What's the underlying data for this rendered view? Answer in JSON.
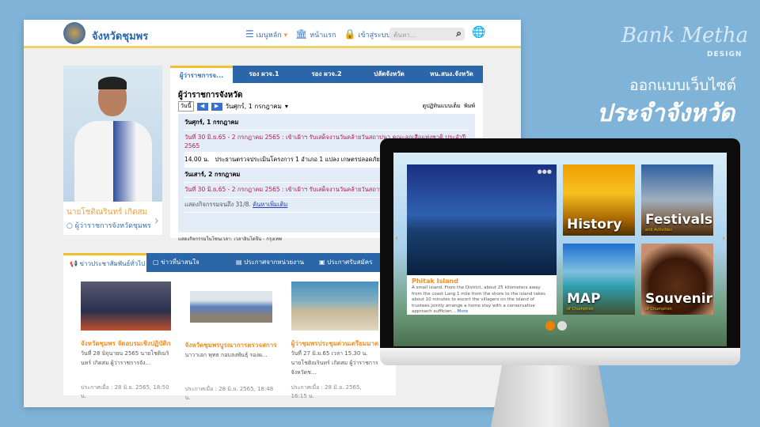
{
  "header": {
    "site_title": "จังหวัดชุมพร",
    "menu": "เมนูหลัก",
    "home": "หน้าแรก",
    "login": "เข้าสู่ระบบ",
    "search_placeholder": "ค้นหา..."
  },
  "profile": {
    "name": "นายโชติณรินทร์ เกิดสม",
    "role": "ผู้ว่าราชการจังหวัดชุมพร"
  },
  "calendar": {
    "tabs": [
      "ผู้ว่าราชการจ...",
      "รอง ผวจ.1",
      "รอง ผวจ.2",
      "ปลัดจังหวัด",
      "หน.สนง.จังหวัด"
    ],
    "title": "ผู้ว่าราชการจังหวัด",
    "today": "วันนี้",
    "current_date": "วันศุกร์, 1 กรกฎาคม",
    "view_full": "ดูปฏิทินแบบเต็ม",
    "print": "พิมพ์",
    "days": [
      {
        "date": "วันศุกร์, 1 กรกฎาคม",
        "events": [
          "วันที่ 30 มิ.ย.65 - 2 กรกฎาคม 2565 : เข้าเฝ้าฯ รับเสด็จงานวันคล้ายวันสถาปนา คณะลูกเสือแห่งชาติ ประจำปี 2565",
          "14.00 น.   ประธานตรวจประเมินโครงการ 1 อำเภอ 1 แปลง เกษตรปลอดภัยต้นแบบ"
        ]
      },
      {
        "date": "วันเสาร์, 2 กรกฎาคม",
        "events": [
          "วันที่ 30 มิ.ย.65 - 2 กรกฎาคม 2565 : เข้าเฝ้าฯ รับเสด็จงานวันคล้ายวันสถาปนา คณะ"
        ]
      }
    ],
    "shown_until": "แสดงกิจกรรมจนถึง 31/8.",
    "search_more": "ค้นหาเพิ่มเติม",
    "timezone": "แสดงกิจกรรมในโซนเวลา: เวลาอินโดจีน - กรุงเทพ"
  },
  "news": {
    "tabs": [
      "ข่าวประชาสัมพันธ์ทั่วไป",
      "ข่าวที่น่าสนใจ",
      "ประกาศจากหน่วยงาน",
      "ประกาศรับสมัคร"
    ],
    "items": [
      {
        "title": "จังหวัดชุมพร จัดอบรมเชิงปฏิบัติก",
        "body": "วันที่ 28 มิถุนายน 2565 นายโชติณรินทร์ เกิดสม ผู้ว่าราชการจัง...",
        "date": "ประกาศเมื่อ : 28 มิ.ย. 2565, 18:50 น."
      },
      {
        "title": "จังหวัดชุมพรบูรณาการตรวจสการ",
        "body": "นาวาเอก พุทธ กอบลงพันธุ์ รองผ...",
        "date": "ประกาศเมื่อ : 28 มิ.ย. 2565, 18:48 น."
      },
      {
        "title": "ผู้ว่าชุมพรประชุมด่วนเตรียมมาต",
        "body": "วันที่ 27 มิ.ย.65 เวลา 15.30 น. นายโชติณรินทร์ เกิดสม ผู้ว่าราชการจังหวัดช...",
        "date": "ประกาศเมื่อ : 28 มิ.ย. 2565, 16:15 น."
      }
    ]
  },
  "promo": {
    "brand": "Bank Metha",
    "brand_sub": "DESIGN",
    "line1": "ออกแบบเว็บไซต์",
    "line2": "ประจำจังหวัด"
  },
  "monitor": {
    "feature": {
      "title": "Phitak Island",
      "body": "A small island. From the District, about 25 kilometers away from the coast Lang 1 mile from the shore to the island takes about 10 minutes to escort the villagers on the island of trustees jointly arrange a home stay with a conservative approach sufficien...",
      "more": "More"
    },
    "tiles": [
      {
        "title": "History",
        "sub": ""
      },
      {
        "title": "Festivals",
        "sub": "and Activities"
      },
      {
        "title": "MAP",
        "sub": "of Chumphon"
      },
      {
        "title": "Souvenir",
        "sub": "of Chumphon"
      }
    ]
  }
}
